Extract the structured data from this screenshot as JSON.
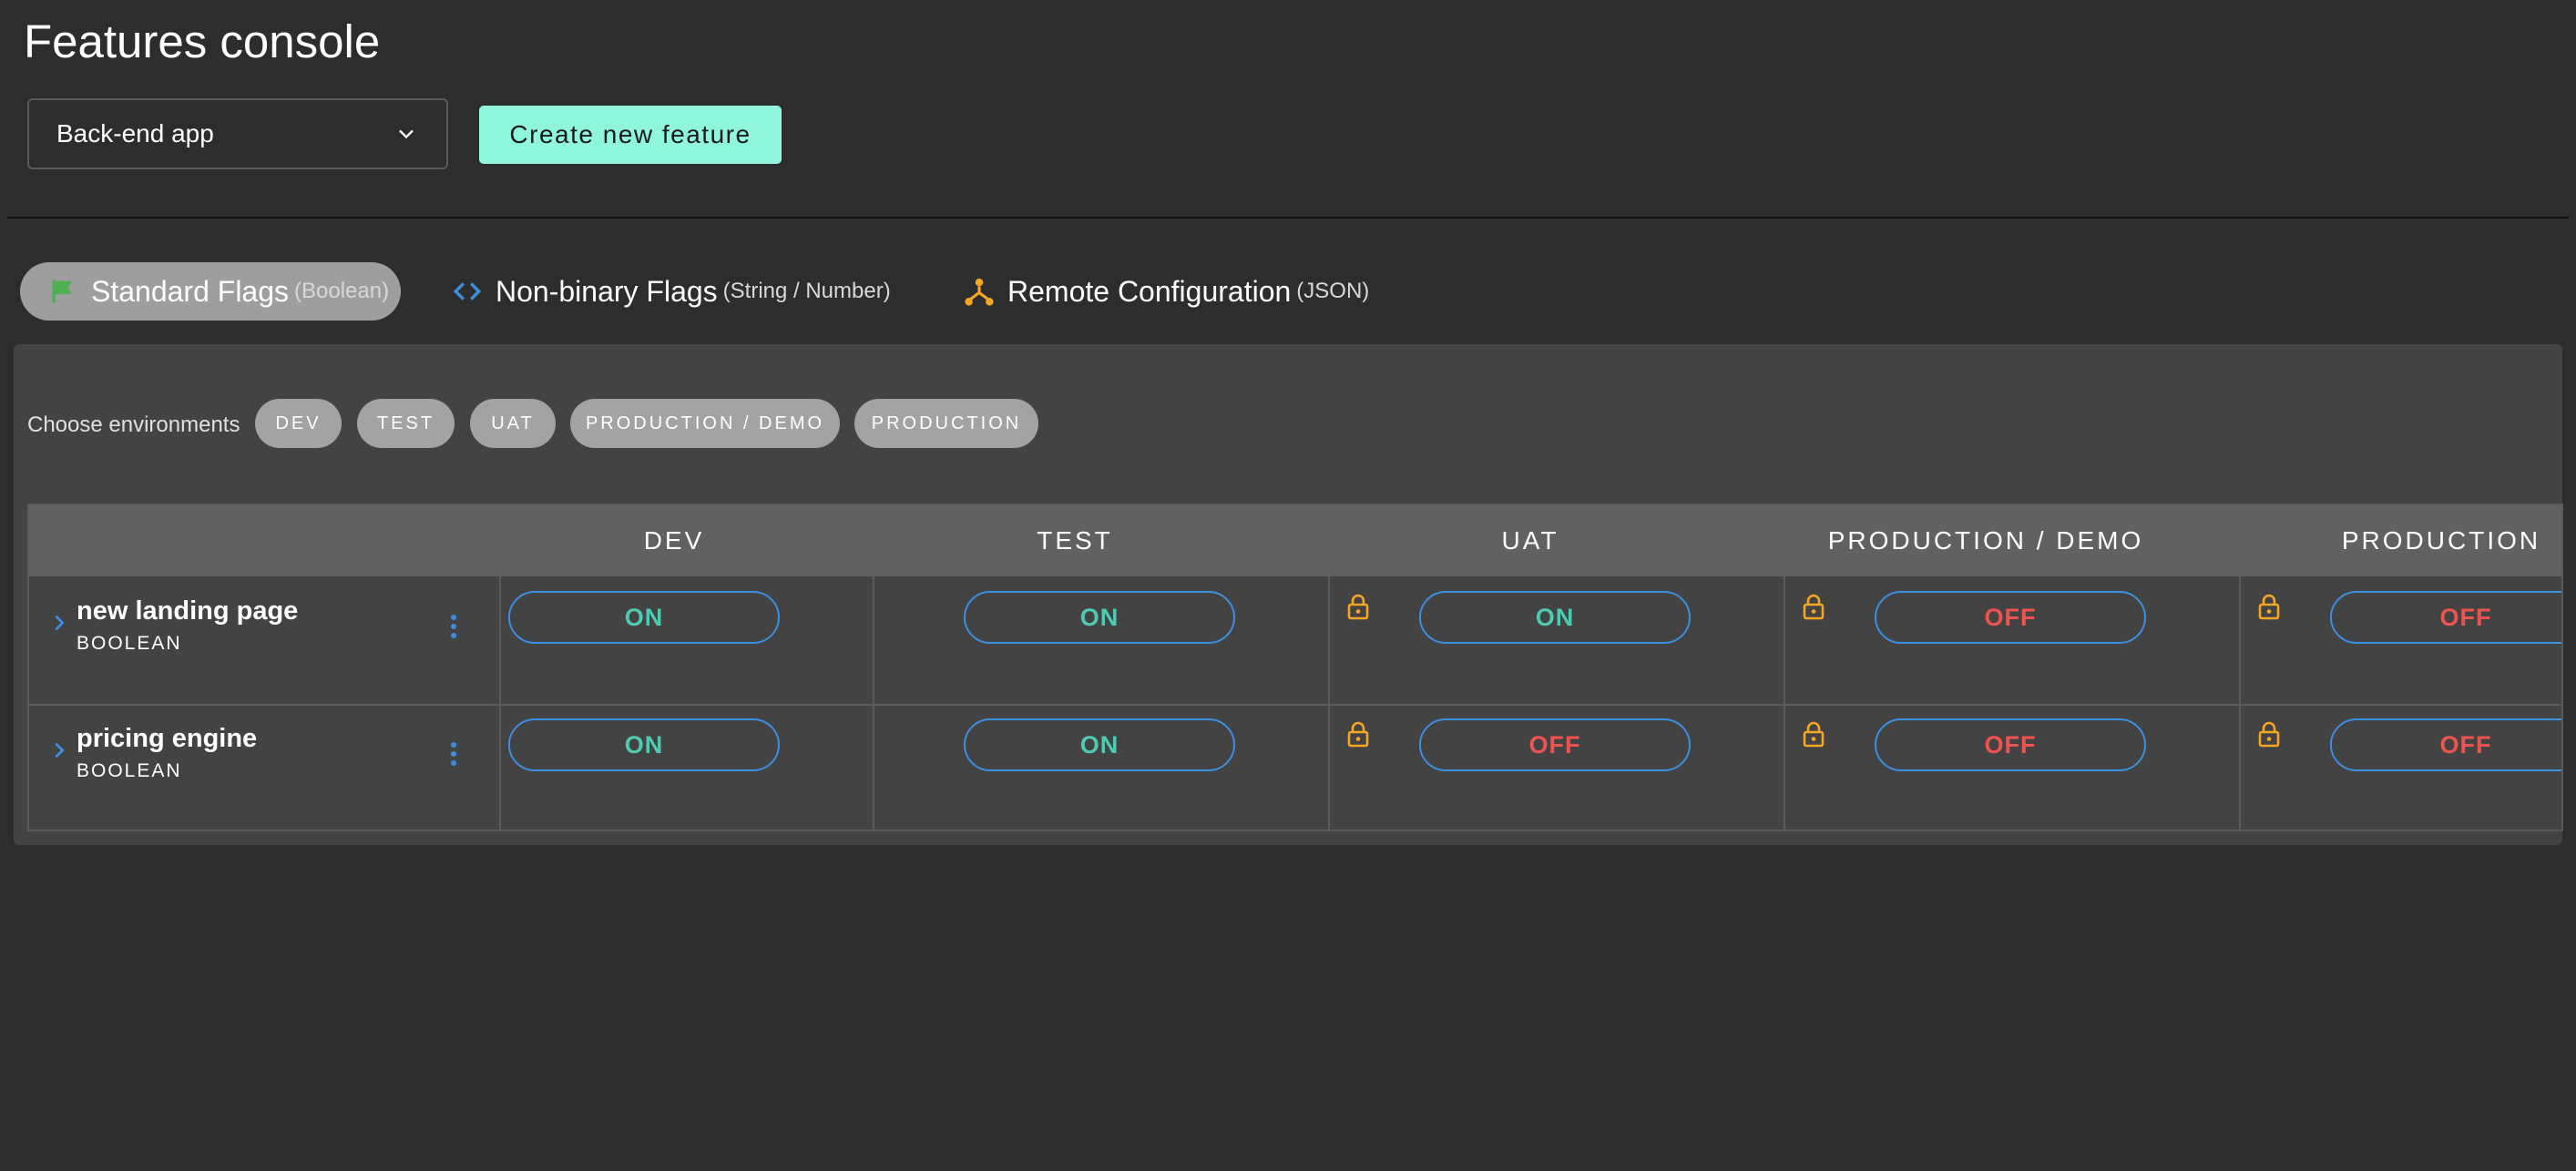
{
  "header": {
    "title": "Features console",
    "app_select": {
      "value": "Back-end app"
    },
    "create_button": "Create new feature"
  },
  "tabs": [
    {
      "label": "Standard Flags",
      "sub": "(Boolean)",
      "icon": "flag-icon",
      "active": true
    },
    {
      "label": "Non-binary Flags",
      "sub": "(String / Number)",
      "icon": "code-icon",
      "active": false
    },
    {
      "label": "Remote Configuration",
      "sub": "(JSON)",
      "icon": "hub-icon",
      "active": false
    }
  ],
  "environments": {
    "label": "Choose environments",
    "chips": [
      "DEV",
      "TEST",
      "UAT",
      "PRODUCTION / DEMO",
      "PRODUCTION"
    ]
  },
  "table": {
    "columns": [
      "DEV",
      "TEST",
      "UAT",
      "PRODUCTION / DEMO",
      "PRODUCTION"
    ],
    "rows": [
      {
        "name": "new landing page",
        "type": "BOOLEAN",
        "values": [
          "ON",
          "ON",
          "ON",
          "OFF",
          "OFF"
        ],
        "locked": [
          false,
          false,
          true,
          true,
          true
        ]
      },
      {
        "name": "pricing engine",
        "type": "BOOLEAN",
        "values": [
          "ON",
          "ON",
          "OFF",
          "OFF",
          "OFF"
        ],
        "locked": [
          false,
          false,
          true,
          true,
          true
        ]
      }
    ]
  },
  "colors": {
    "background": "#2d2d2d",
    "accent_button": "#8ff5dd",
    "on_text": "#4ecbb2",
    "off_text": "#ef5350",
    "toggle_border": "#3d8fe0",
    "lock": "#f5a623",
    "flag": "#4caf50"
  }
}
